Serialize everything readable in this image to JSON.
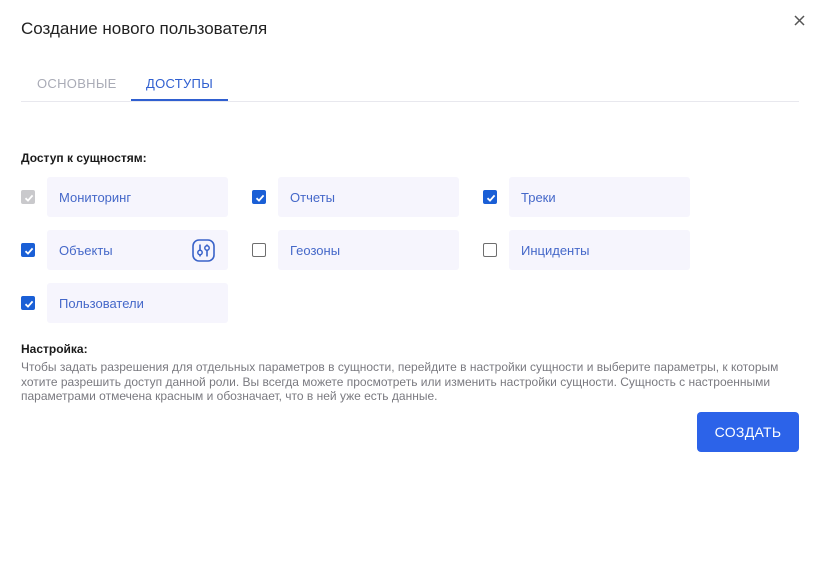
{
  "dialog": {
    "title": "Создание нового пользователя",
    "close_icon": "close-icon"
  },
  "tabs": [
    {
      "label": "ОСНОВНЫЕ",
      "active": false
    },
    {
      "label": "ДОСТУПЫ",
      "active": true
    }
  ],
  "entities": {
    "section_label": "Доступ к сущностям:",
    "items": [
      {
        "label": "Мониторинг",
        "checked": true,
        "disabled": true
      },
      {
        "label": "Отчеты",
        "checked": true,
        "disabled": false
      },
      {
        "label": "Треки",
        "checked": true,
        "disabled": false
      },
      {
        "label": "Объекты",
        "checked": true,
        "disabled": false,
        "has_settings_icon": true
      },
      {
        "label": "Геозоны",
        "checked": false,
        "disabled": false
      },
      {
        "label": "Инциденты",
        "checked": false,
        "disabled": false
      },
      {
        "label": "Пользователи",
        "checked": true,
        "disabled": false
      }
    ]
  },
  "setting": {
    "title": "Настройка:",
    "description": "Чтобы задать разрешения для отдельных параметров в сущности, перейдите в настройки сущности и выберите параметры, к которым хотите разрешить доступ данной роли. Вы всегда можете просмотреть или изменить настройки сущности. Сущность с настроенными параметрами отмечена красным и обозначает, что в ней уже есть данные."
  },
  "actions": {
    "create_label": "СОЗДАТЬ"
  },
  "colors": {
    "accent": "#2c63e9",
    "checkbox_checked": "#1a5fd6",
    "entity_text": "#4568c9",
    "entity_bg": "#f6f5fd"
  }
}
